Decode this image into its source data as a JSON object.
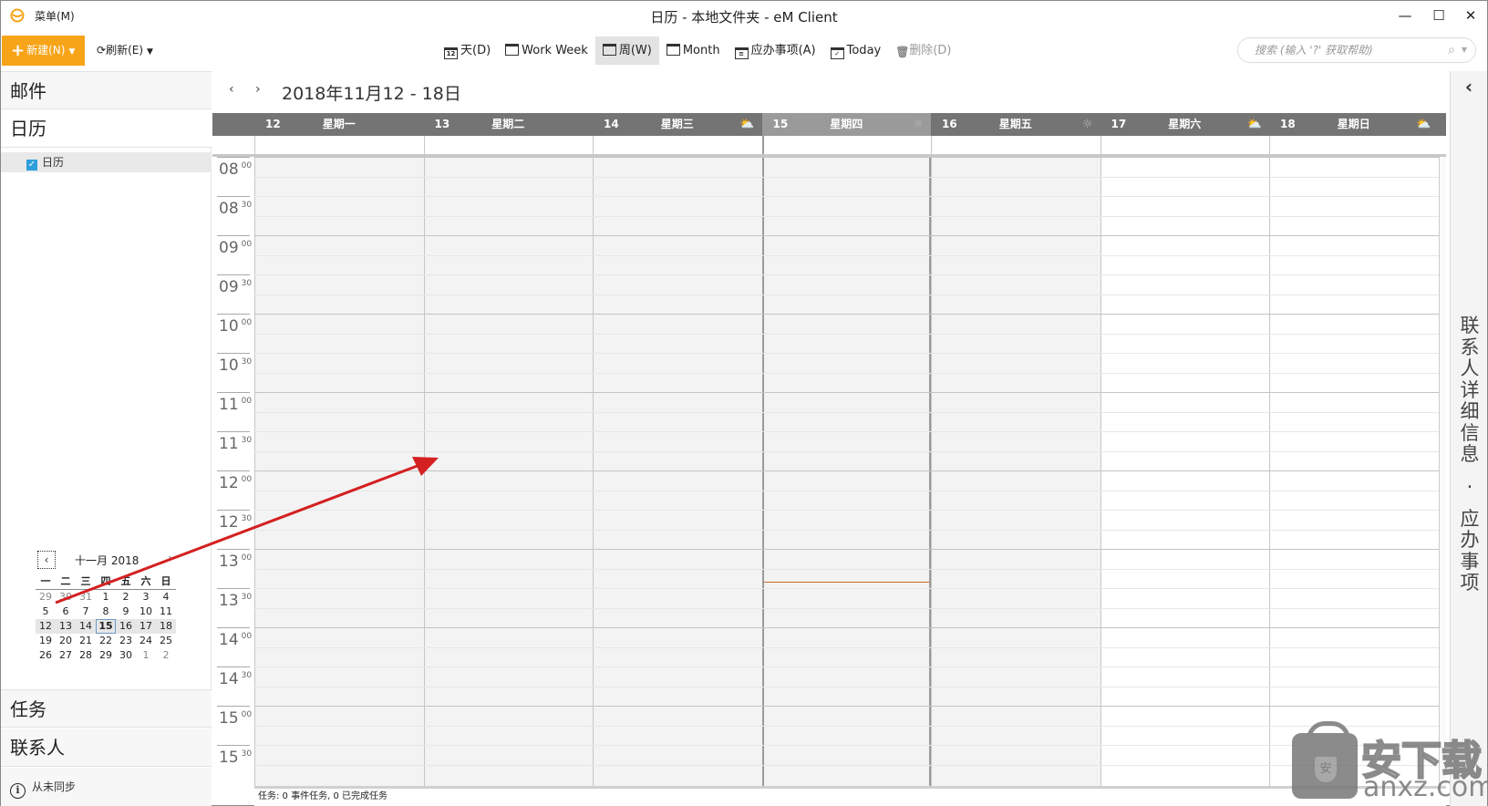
{
  "window": {
    "menu_label": "菜单(M)",
    "title": "日历 - 本地文件夹 - eM Client",
    "controls": [
      "minimize",
      "maximize",
      "close"
    ]
  },
  "toolbar": {
    "new_label": "新建(N)",
    "refresh_label": "刷新(E)",
    "views": [
      {
        "id": "day",
        "label": "天(D)",
        "icon": "calendar-day-icon",
        "icon_text": "12",
        "active": false,
        "disabled": false
      },
      {
        "id": "work-week",
        "label": "Work Week",
        "icon": "calendar-workweek-icon",
        "icon_text": "",
        "active": false,
        "disabled": false
      },
      {
        "id": "week",
        "label": "周(W)",
        "icon": "calendar-week-icon",
        "icon_text": "",
        "active": true,
        "disabled": false
      },
      {
        "id": "month",
        "label": "Month",
        "icon": "calendar-month-icon",
        "icon_text": "",
        "active": false,
        "disabled": false
      },
      {
        "id": "agenda",
        "label": "应办事项(A)",
        "icon": "agenda-icon",
        "icon_text": "≡",
        "active": false,
        "disabled": false
      },
      {
        "id": "today",
        "label": "Today",
        "icon": "calendar-today-icon",
        "icon_text": "✓",
        "active": false,
        "disabled": false
      },
      {
        "id": "delete",
        "label": "删除(D)",
        "icon": "trash-icon",
        "icon_text": "🗑",
        "active": false,
        "disabled": true
      }
    ],
    "search_placeholder": "搜索 (输入 '?' 获取帮助)"
  },
  "sidebar": {
    "mail": "邮件",
    "calendar": "日历",
    "calendar_item": {
      "label": "日历",
      "checked": true
    },
    "tasks": "任务",
    "contacts": "联系人",
    "sync_status": "从未同步",
    "mini_calendar": {
      "title": "十一月 2018",
      "prev": "‹",
      "next": "›",
      "weekdays": [
        "一",
        "二",
        "三",
        "四",
        "五",
        "六",
        "日"
      ],
      "weeks": [
        [
          {
            "d": "29",
            "o": true
          },
          {
            "d": "30",
            "o": true
          },
          {
            "d": "31",
            "o": true
          },
          {
            "d": "1"
          },
          {
            "d": "2"
          },
          {
            "d": "3"
          },
          {
            "d": "4"
          }
        ],
        [
          {
            "d": "5"
          },
          {
            "d": "6"
          },
          {
            "d": "7"
          },
          {
            "d": "8"
          },
          {
            "d": "9"
          },
          {
            "d": "10"
          },
          {
            "d": "11"
          }
        ],
        [
          {
            "d": "12",
            "w": true
          },
          {
            "d": "13",
            "w": true
          },
          {
            "d": "14",
            "w": true
          },
          {
            "d": "15",
            "w": true,
            "t": true
          },
          {
            "d": "16",
            "w": true
          },
          {
            "d": "17",
            "w": true
          },
          {
            "d": "18",
            "w": true
          }
        ],
        [
          {
            "d": "19"
          },
          {
            "d": "20"
          },
          {
            "d": "21"
          },
          {
            "d": "22"
          },
          {
            "d": "23"
          },
          {
            "d": "24"
          },
          {
            "d": "25"
          }
        ],
        [
          {
            "d": "26"
          },
          {
            "d": "27"
          },
          {
            "d": "28"
          },
          {
            "d": "29"
          },
          {
            "d": "30"
          },
          {
            "d": "1",
            "o": true
          },
          {
            "d": "2",
            "o": true
          }
        ]
      ]
    }
  },
  "calendar": {
    "prev": "‹",
    "next": "›",
    "range_title": "2018年11月12 - 18日",
    "days": [
      {
        "num": "12",
        "name": "星期一",
        "weather": "",
        "today": false,
        "weekend": false
      },
      {
        "num": "13",
        "name": "星期二",
        "weather": "",
        "today": false,
        "weekend": false
      },
      {
        "num": "14",
        "name": "星期三",
        "weather": "partly-cloudy",
        "today": false,
        "weekend": false
      },
      {
        "num": "15",
        "name": "星期四",
        "weather": "sunny",
        "today": true,
        "weekend": false
      },
      {
        "num": "16",
        "name": "星期五",
        "weather": "sunny",
        "today": false,
        "weekend": false
      },
      {
        "num": "17",
        "name": "星期六",
        "weather": "partly-cloudy",
        "today": false,
        "weekend": true
      },
      {
        "num": "18",
        "name": "星期日",
        "weather": "partly-cloudy",
        "today": false,
        "weekend": true
      }
    ],
    "time_slots": [
      {
        "h": "08",
        "m": "00"
      },
      {
        "h": "08",
        "m": "30"
      },
      {
        "h": "09",
        "m": "00"
      },
      {
        "h": "09",
        "m": "30"
      },
      {
        "h": "10",
        "m": "00"
      },
      {
        "h": "10",
        "m": "30"
      },
      {
        "h": "11",
        "m": "00"
      },
      {
        "h": "11",
        "m": "30"
      },
      {
        "h": "12",
        "m": "00"
      },
      {
        "h": "12",
        "m": "30"
      },
      {
        "h": "13",
        "m": "00"
      },
      {
        "h": "13",
        "m": "30"
      },
      {
        "h": "14",
        "m": "00"
      },
      {
        "h": "14",
        "m": "30"
      },
      {
        "h": "15",
        "m": "00"
      },
      {
        "h": "15",
        "m": "30"
      }
    ],
    "current_time": "13:25",
    "status": "任务: 0 事件任务, 0 已完成任务"
  },
  "right_panel": {
    "collapse": "‹",
    "label": "联系人详细信息 · 应办事项"
  },
  "watermark": {
    "cn": "安下载",
    "en": "anxz.com"
  },
  "colors": {
    "accent": "#f7a418",
    "header_bg": "#747474",
    "today_header_bg": "#9a9a9a",
    "now_line": "#d06a2c",
    "checkbox": "#2d9fdc",
    "annotation_arrow": "#d42020"
  }
}
